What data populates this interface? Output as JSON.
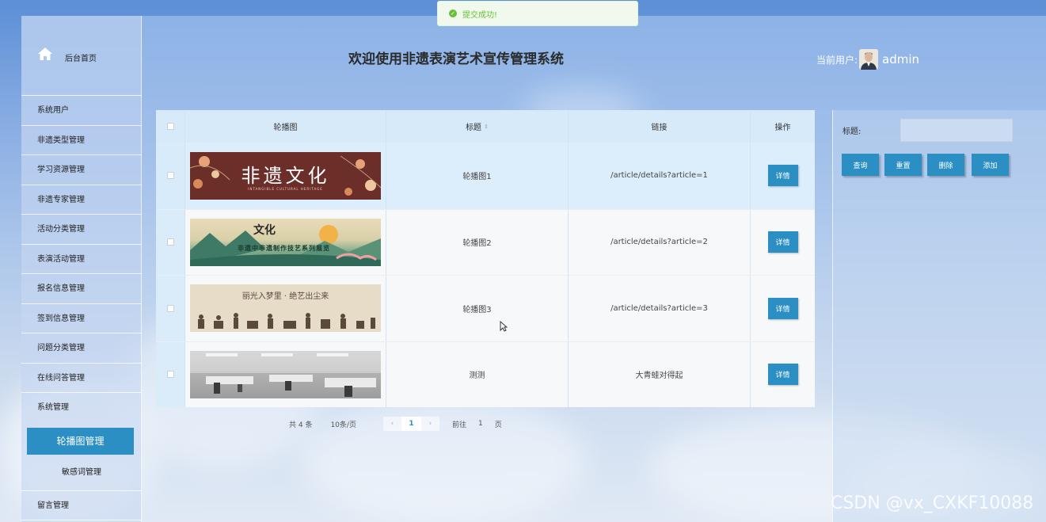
{
  "toast": {
    "text": "提交成功!"
  },
  "header": {
    "title": "欢迎使用非遗表演艺术宣传管理系统",
    "user_prefix": "当前用户:",
    "user_name": "admin"
  },
  "sidebar": {
    "home_label": "后台首页",
    "items": [
      {
        "label": "系统用户"
      },
      {
        "label": "非遗类型管理"
      },
      {
        "label": "学习资源管理"
      },
      {
        "label": "非遗专家管理"
      },
      {
        "label": "活动分类管理"
      },
      {
        "label": "表演活动管理"
      },
      {
        "label": "报名信息管理"
      },
      {
        "label": "签到信息管理"
      },
      {
        "label": "问题分类管理"
      },
      {
        "label": "在线问答管理"
      },
      {
        "label": "系统管理"
      }
    ],
    "submenu": [
      {
        "label": "轮播图管理",
        "active": true
      },
      {
        "label": "敏感词管理",
        "active": false
      }
    ],
    "last_item": "留言管理"
  },
  "table": {
    "columns": [
      "轮播图",
      "标题",
      "链接",
      "操作"
    ],
    "rows": [
      {
        "image_text": "非遗文化",
        "image_sub": "INTANGIBLE CULTURAL HERITAGE",
        "title": "轮播图1",
        "link": "/article/details?article=1",
        "action": "详情"
      },
      {
        "image_text": "文化",
        "image_sub": "非遗中非遗制作技艺系列展览",
        "title": "轮播图2",
        "link": "/article/details?article=2",
        "action": "详情"
      },
      {
        "image_text": "丽光入梦里 · 绝艺出尘来",
        "image_sub": "",
        "title": "轮播图3",
        "link": "/article/details?article=3",
        "action": "详情"
      },
      {
        "image_text": "",
        "image_sub": "",
        "title": "测测",
        "link": "大青蛙对得起",
        "action": "详情"
      }
    ]
  },
  "pagination": {
    "total": "共 4 条",
    "page_size": "10条/页",
    "current_page": "1",
    "goto_prefix": "前往",
    "goto_value": "1",
    "goto_suffix": "页"
  },
  "filter": {
    "label": "标题:",
    "value": "",
    "buttons": [
      "查询",
      "重置",
      "删除",
      "添加"
    ]
  },
  "watermark": "CSDN @vx_CXKF10088",
  "colors": {
    "accent": "#2b8fc4",
    "success": "#67c23a",
    "header_row": "#d7eaf9"
  }
}
